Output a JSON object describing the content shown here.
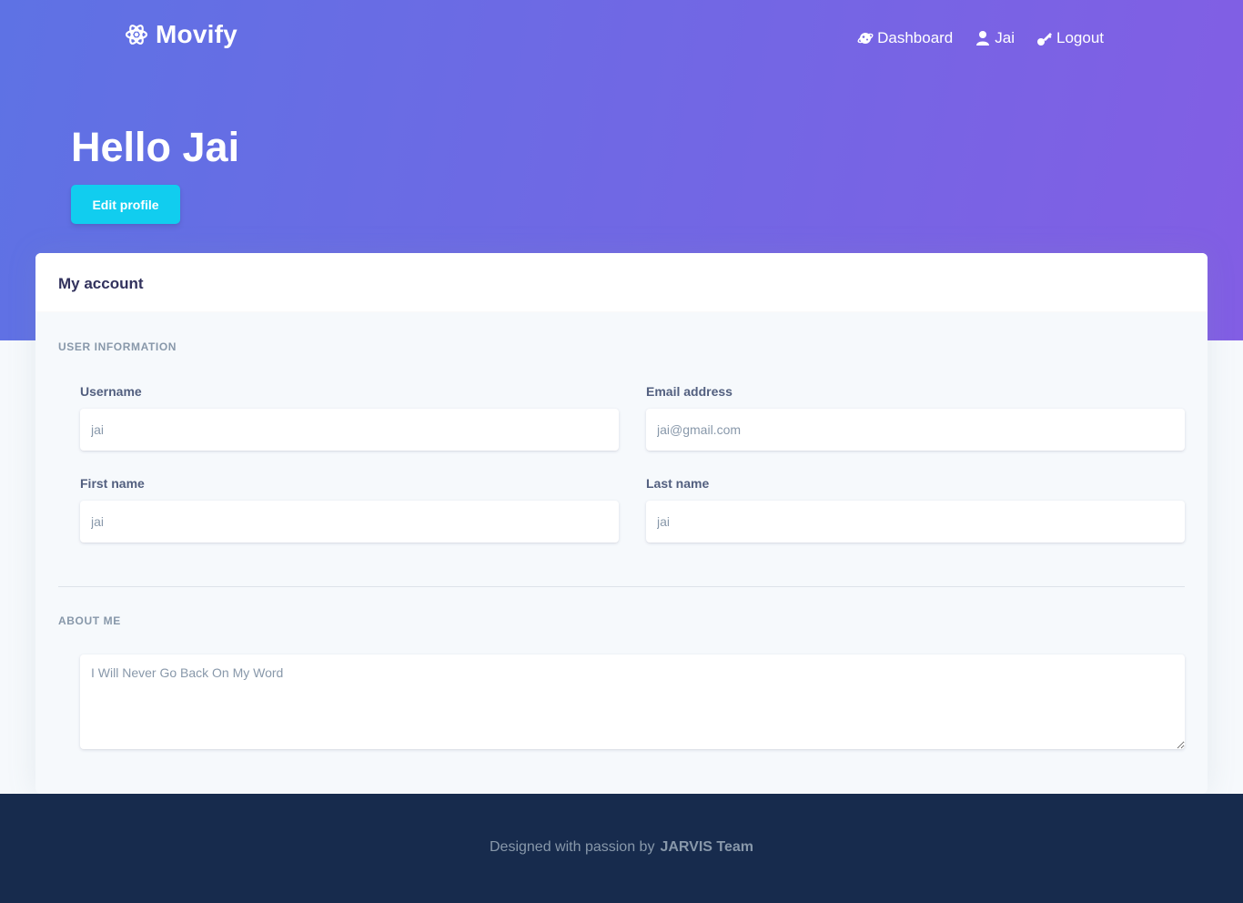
{
  "brand": {
    "name": "Movify",
    "icon": "atom-icon"
  },
  "nav": {
    "items": [
      {
        "label": "Dashboard",
        "icon": "planet-icon"
      },
      {
        "label": "Jai",
        "icon": "user-icon"
      },
      {
        "label": "Logout",
        "icon": "key-icon"
      }
    ]
  },
  "hero": {
    "greeting": "Hello Jai",
    "edit_button": "Edit profile"
  },
  "card": {
    "title": "My account",
    "user_info_heading": "User information",
    "fields": {
      "username": {
        "label": "Username",
        "placeholder": "jai"
      },
      "email": {
        "label": "Email address",
        "placeholder": "jai@gmail.com"
      },
      "first_name": {
        "label": "First name",
        "placeholder": "jai"
      },
      "last_name": {
        "label": "Last name",
        "placeholder": "jai"
      }
    },
    "about_heading": "About me",
    "about": {
      "placeholder": "I Will Never Go Back On My Word"
    }
  },
  "footer": {
    "text": "Designed with passion by",
    "link": "JARVIS Team"
  },
  "colors": {
    "hero_start": "#5e72e4",
    "hero_end": "#825ee4",
    "accent_button": "#11cdef",
    "footer_bg": "#172b4d",
    "page_bg": "#f6f9fc"
  }
}
